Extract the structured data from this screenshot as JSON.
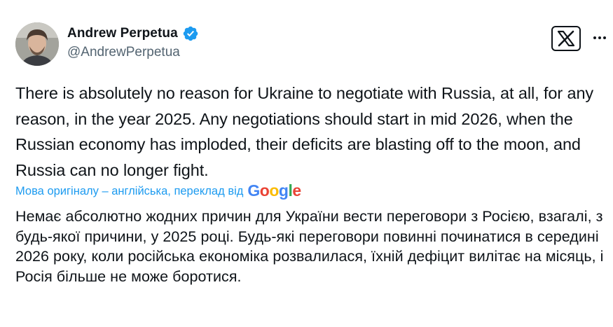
{
  "author": {
    "display_name": "Andrew Perpetua",
    "handle": "@AndrewPerpetua",
    "verified": true,
    "verified_color": "#1d9bf0"
  },
  "tweet": {
    "text": "There is absolutely no reason for Ukraine to negotiate with Russia, at all, for any reason, in the year 2025. Any negotiations should start in mid 2026, when the Russian economy has imploded, their deficits are blasting off to the moon, and Russia can no longer fight."
  },
  "translation": {
    "label": "Мова оригіналу – англійська, переклад від",
    "provider": "Google",
    "text": "Немає абсолютно жодних причин для України вести переговори з Росією, взагалі, з будь-якої причини, у 2025 році. Будь-які переговори повинні починатися в середині 2026 року, коли російська економіка розвалилася, їхній дефіцит вилітає на місяць, і Росія більше не може боротися."
  },
  "icons": {
    "avatar": "avatar",
    "verified": "verified-badge-icon",
    "brand": "x-logo-icon",
    "more": "more-icon"
  },
  "colors": {
    "text_primary": "#0f1419",
    "text_secondary": "#536471",
    "link": "#1d9bf0"
  }
}
